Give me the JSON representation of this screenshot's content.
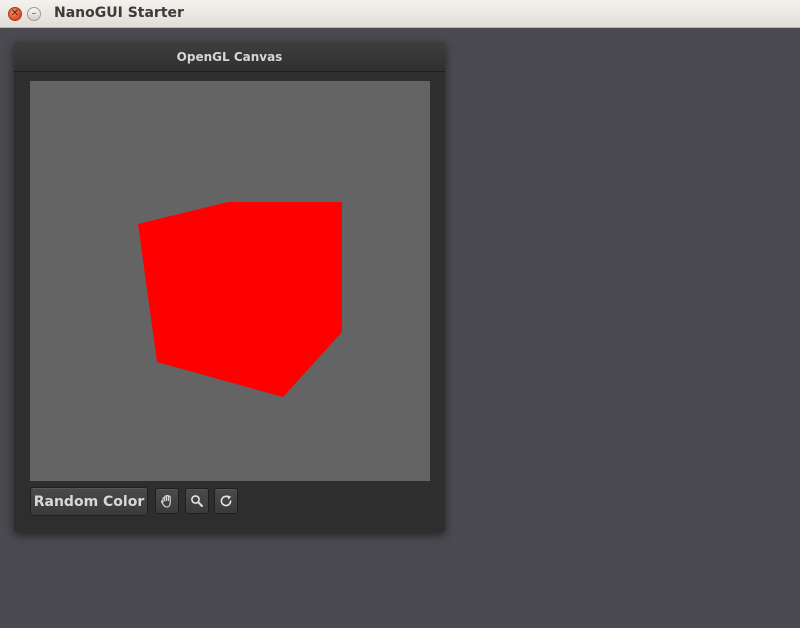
{
  "window": {
    "title": "NanoGUI Starter",
    "close_glyph": "✕",
    "minimize_glyph": "–"
  },
  "panel": {
    "title": "OpenGL Canvas"
  },
  "canvas": {
    "background_color": "#646464",
    "cube_color": "#ff0000"
  },
  "toolbar": {
    "random_color_label": "Random Color",
    "icons": [
      "hand-pan-icon",
      "magnifier-zoom-icon",
      "rotate-icon"
    ]
  }
}
